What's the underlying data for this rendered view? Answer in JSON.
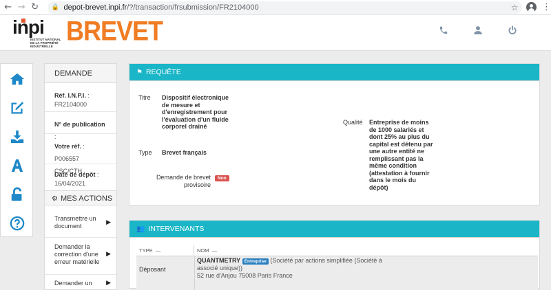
{
  "browser": {
    "url_host": "depot-brevet.inpi.fr",
    "url_path": "/?/transaction/frsubmission/FR2104000"
  },
  "header": {
    "logo_word": "inpi",
    "logo_subtitle": "INSTITUT NATIONAL DE LA PROPRIÉTÉ INDUSTRIELLE",
    "brand": "BREVET",
    "icons": [
      "phone-icon",
      "user-icon",
      "power-icon"
    ]
  },
  "sidebar_icons": [
    "home-icon",
    "edit-icon",
    "download-icon",
    "font-icon",
    "unlock-icon",
    "help-icon"
  ],
  "demande": {
    "title": "DEMANDE",
    "ref_inpi_label": "Réf. I.N.P.I.",
    "ref_inpi_value": "FR2104000",
    "publication_label": "N° de publication",
    "votre_ref_label": "Votre réf.",
    "votre_ref_value": "P006557 CSC/CTH",
    "date_depot_label": "Date de dépôt",
    "date_depot_value": "16/04/2021",
    "mes_actions_title": "MES ACTIONS",
    "actions": [
      "Transmettre un document",
      "Demander la correction d'une erreur matérielle",
      "Demander un"
    ]
  },
  "requete": {
    "title": "REQUÊTE",
    "titre_label": "Titre",
    "titre_value": "Dispositif électronique de mesure et d'enregistrement pour l'évaluation d'un fluide corporel drainé",
    "type_label": "Type",
    "type_value": "Brevet français",
    "provisoire_label": "Demande de brevet provisoire",
    "provisoire_value": "Non",
    "qualite_label": "Qualité",
    "qualite_value": "Entreprise de moins de 1000 salariés et dont 25% au plus du capital est détenu par une autre entité ne remplissant pas la même condition (attestation à fournir dans le mois du dépôt)"
  },
  "intervenants": {
    "title": "INTERVENANTS",
    "columns": [
      "TYPE",
      "NOM"
    ],
    "rows": [
      {
        "type": "Déposant",
        "name": "QUANTMETRY",
        "badge": "Entreprise",
        "detail": "(Société par actions simplifiée (Société à associé unique))",
        "address": "52 rue d'Anjou 75008 Paris France"
      }
    ]
  }
}
